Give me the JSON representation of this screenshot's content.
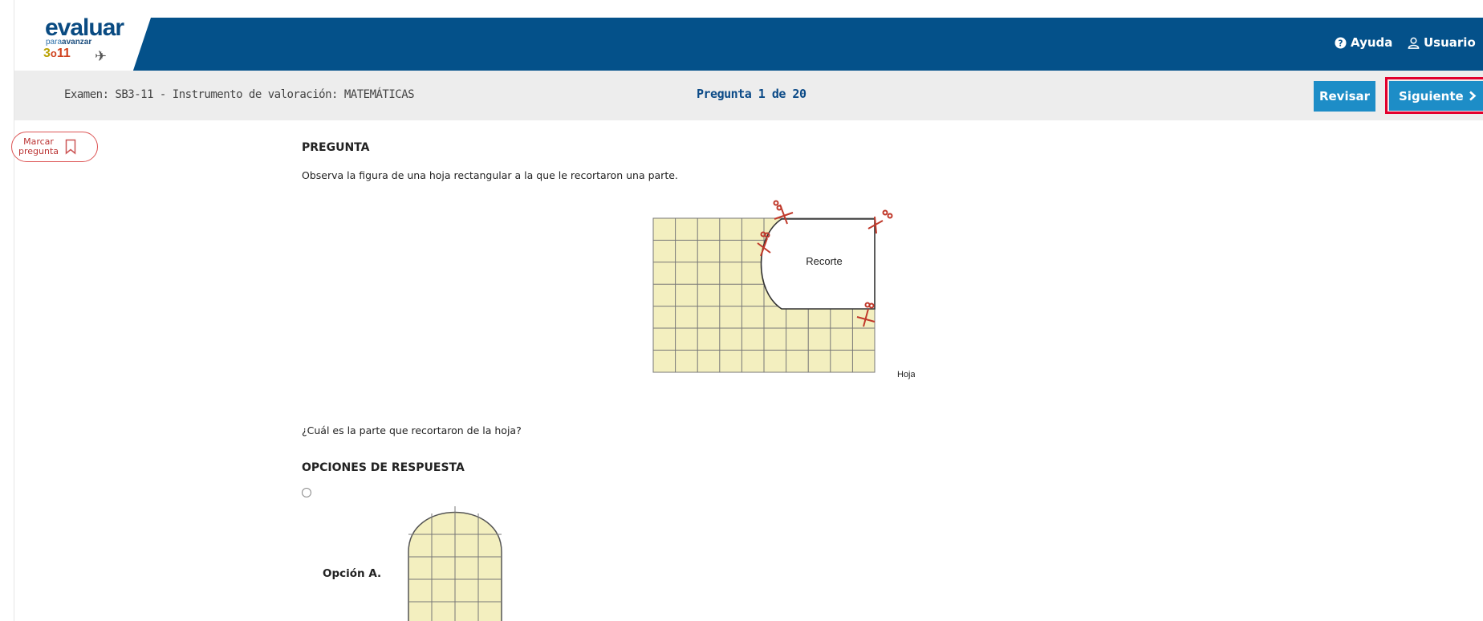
{
  "brand": {
    "logo_word": "evaluar",
    "logo_sub_1": "para",
    "logo_sub_2": "avanzar",
    "logo_grade_3": "3",
    "logo_grade_o": "o",
    "logo_grade_11": "11",
    "header_color": "#04518a"
  },
  "header": {
    "help_label": "Ayuda",
    "user_label": "Usuario",
    "help_icon": "help-circle-icon",
    "user_icon": "user-icon"
  },
  "exam": {
    "title": "Examen: SB3-11 - Instrumento de valoración: MATEMÁTICAS",
    "progress": "Pregunta 1 de 20",
    "review_label": "Revisar",
    "next_label": "Siguiente",
    "next_icon": "chevron-right-icon",
    "accent_color": "#1d8dc7",
    "highlight_color": "#e3002d"
  },
  "mark": {
    "label_line1": "Marcar",
    "label_line2": "pregunta",
    "icon": "bookmark-icon"
  },
  "question": {
    "section_title": "PREGUNTA",
    "statement": "Observa la figura de una hoja rectangular a la que le recortaron una parte.",
    "figure_cut_label": "Recorte",
    "figure_sheet_label": "Hoja",
    "prompt": "¿Cuál es la parte que recortaron de la hoja?"
  },
  "answers": {
    "section_title": "OPCIONES DE RESPUESTA",
    "options": [
      {
        "label": "Opción A."
      }
    ]
  }
}
